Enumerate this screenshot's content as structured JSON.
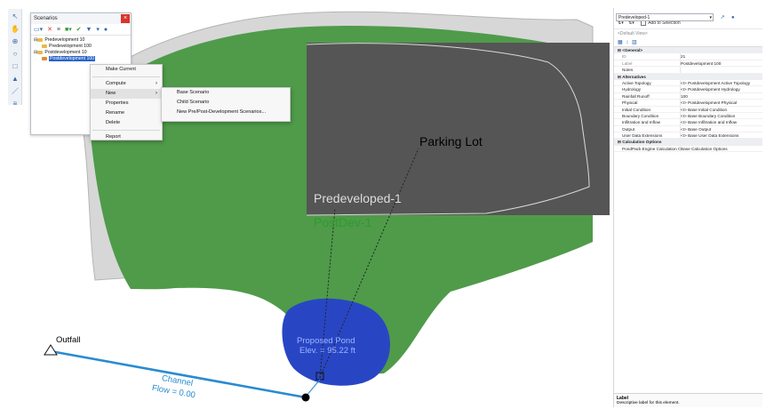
{
  "scenarios_window": {
    "title": "Scenarios",
    "close_glyph": "×",
    "toolbar_icons": [
      "new-icon",
      "delete-icon",
      "rename-icon",
      "compute-icon",
      "make-current-icon",
      "compare-icon",
      "filter-icon",
      "help-icon"
    ],
    "tree": [
      {
        "label": "Predevelopment 10",
        "level": 0
      },
      {
        "label": "Predevelopment 100",
        "level": 1
      },
      {
        "label": "Postdevelopment 10",
        "level": 0
      },
      {
        "label": "Postdevelopment 100",
        "level": 1,
        "selected": true
      }
    ]
  },
  "context_menu": {
    "items": [
      "Make Current",
      "Compute",
      "New",
      "Properties",
      "Rename",
      "Delete",
      "Report"
    ]
  },
  "submenu": {
    "items": [
      "Base Scenario",
      "Child Scenario",
      "New Pre/Post-Development Scenarios..."
    ]
  },
  "canvas": {
    "parking_lot_label": "Parking Lot",
    "predeveloped_label": "Predeveloped-1",
    "postdev_label": "PostDev-1",
    "pond_line1": "Proposed Pond",
    "pond_line2": "Elev. = 95.22 ft",
    "outfall_label": "Outfall",
    "channel_line1": "Channel",
    "channel_line2": "Flow = 0.00",
    "colors": {
      "postdev_green": "#4f9b4a",
      "parking_gray": "#555555",
      "pond_blue": "#2846c4",
      "channel_blue": "#2a8bd1"
    }
  },
  "properties_panel": {
    "element_selector": "Predeveloped-1",
    "find_label": "Find",
    "add_to_selection_label": "Add to Selection",
    "view_selector": "<Default View>",
    "general_header": "<General>",
    "id_label": "ID",
    "id_value": "21",
    "label_label": "Label",
    "label_value": "Postdevelopment 100",
    "notes_label": "Notes",
    "alternatives_header": "Alternatives",
    "alternatives": [
      {
        "key": "Active Topology",
        "value": "<I> Postdevelopment Active Topology"
      },
      {
        "key": "Hydrology",
        "value": "<I> Postdevelopment Hydrology"
      },
      {
        "key": "Rainfall Runoff",
        "value": "100"
      },
      {
        "key": "Physical",
        "value": "<I> Postdevelopment Physical"
      },
      {
        "key": "Initial Condition",
        "value": "<I> Base Initial Condition"
      },
      {
        "key": "Boundary Condition",
        "value": "<I> Base Boundary Condition"
      },
      {
        "key": "Infiltration and Inflow",
        "value": "<I> Base Infiltration and Inflow"
      },
      {
        "key": "Output",
        "value": "<I> Base Output"
      },
      {
        "key": "User Data Extensions",
        "value": "<I> Base User Data Extensions"
      }
    ],
    "calc_header": "Calculation Options",
    "calc_key": "PondPack Engine Calculation Options",
    "calc_value": "Base Calculation Options",
    "desc_title": "Label",
    "desc_text": "Descriptive label for this element."
  }
}
